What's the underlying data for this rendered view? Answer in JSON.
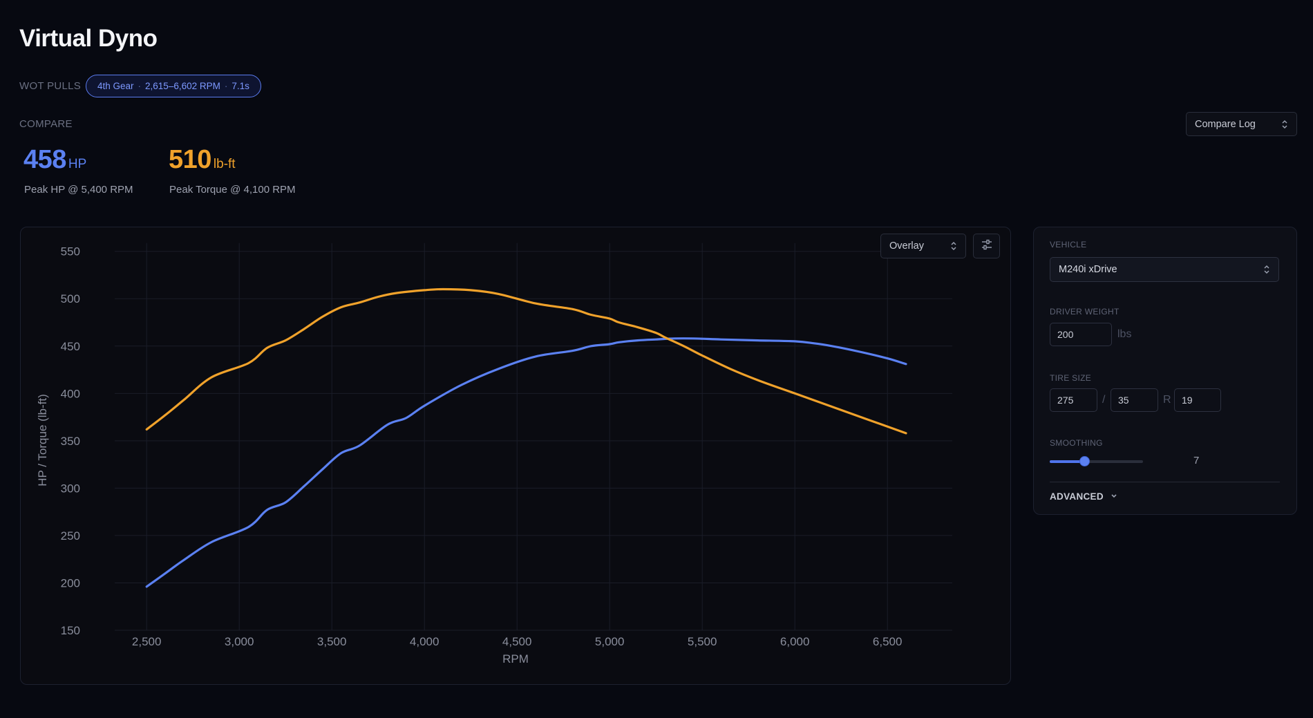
{
  "page": {
    "title": "Virtual Dyno",
    "wot_label": "WOT PULLS",
    "compare_label": "COMPARE"
  },
  "pull_chip": {
    "gear": "4th Gear",
    "rpm_range": "2,615–6,602 RPM",
    "duration": "7.1s"
  },
  "compare_log": {
    "label": "Compare Log"
  },
  "stats": {
    "peak_hp": {
      "value": "458",
      "unit": "HP",
      "caption": "Peak HP @ 5,400 RPM"
    },
    "peak_torque": {
      "value": "510",
      "unit": "lb-ft",
      "caption": "Peak Torque @ 4,100 RPM"
    }
  },
  "chart_controls": {
    "view_mode": "Overlay",
    "settings_icon": "sliders-icon"
  },
  "colors": {
    "hp": "#5b81f2",
    "torque": "#f0a22b",
    "accent": "#4f74ec",
    "background": "#070911"
  },
  "sidebar": {
    "vehicle_label": "VEHICLE",
    "vehicle_value": "M240i xDrive",
    "driver_weight_label": "DRIVER WEIGHT",
    "driver_weight_value": "200",
    "driver_weight_unit": "lbs",
    "tire_size_label": "TIRE SIZE",
    "tire_width": "275",
    "tire_sep": "/",
    "tire_aspect": "35",
    "tire_r": "R",
    "tire_rim": "19",
    "smoothing_label": "SMOOTHING",
    "smoothing_value": "7",
    "smoothing_fraction": 0.37,
    "advanced_label": "ADVANCED"
  },
  "chart_data": {
    "type": "line",
    "title": "",
    "xlabel": "RPM",
    "ylabel": "HP / Torque (lb-ft)",
    "xlim": [
      2350,
      6850
    ],
    "ylim": [
      150,
      560
    ],
    "x_ticks": [
      2500,
      3000,
      3500,
      4000,
      4500,
      5000,
      5500,
      6000,
      6500
    ],
    "x_tick_labels": [
      "2,500",
      "3,000",
      "3,500",
      "4,000",
      "4,500",
      "5,000",
      "5,500",
      "6,000",
      "6,500"
    ],
    "y_ticks": [
      150,
      200,
      250,
      300,
      350,
      400,
      450,
      500,
      550
    ],
    "y_tick_labels": [
      "150",
      "200",
      "250",
      "300",
      "350",
      "400",
      "450",
      "500",
      "550"
    ],
    "grid": true,
    "series": [
      {
        "key": "hp",
        "color": "#5b81f2",
        "x": [
          2500,
          2600,
          2700,
          2850,
          3050,
          3150,
          3250,
          3350,
          3450,
          3550,
          3650,
          3800,
          3900,
          4000,
          4200,
          4400,
          4600,
          4800,
          4900,
          5000,
          5050,
          5150,
          5250,
          5350,
          5450,
          5600,
          5800,
          6000,
          6100,
          6200,
          6350,
          6500,
          6600
        ],
        "y": [
          196,
          210,
          224,
          243,
          259,
          277,
          285,
          302,
          320,
          337,
          345,
          367,
          374,
          387,
          409,
          426,
          439,
          445,
          450,
          452,
          454,
          456,
          457,
          458,
          458,
          457,
          456,
          455,
          453,
          450,
          444,
          437,
          431
        ]
      },
      {
        "key": "torque",
        "color": "#f0a22b",
        "x": [
          2500,
          2600,
          2700,
          2850,
          3050,
          3150,
          3250,
          3350,
          3450,
          3550,
          3650,
          3750,
          3850,
          4000,
          4100,
          4250,
          4400,
          4600,
          4800,
          4900,
          5000,
          5050,
          5150,
          5250,
          5300,
          5400,
          5500,
          5650,
          5800,
          6000,
          6200,
          6400,
          6600
        ],
        "y": [
          362,
          377,
          393,
          417,
          432,
          448,
          456,
          468,
          481,
          491,
          496,
          502,
          506,
          509,
          510,
          509,
          505,
          495,
          489,
          483,
          479,
          475,
          470,
          464,
          459,
          450,
          440,
          426,
          414,
          400,
          386,
          372,
          358
        ]
      }
    ]
  }
}
